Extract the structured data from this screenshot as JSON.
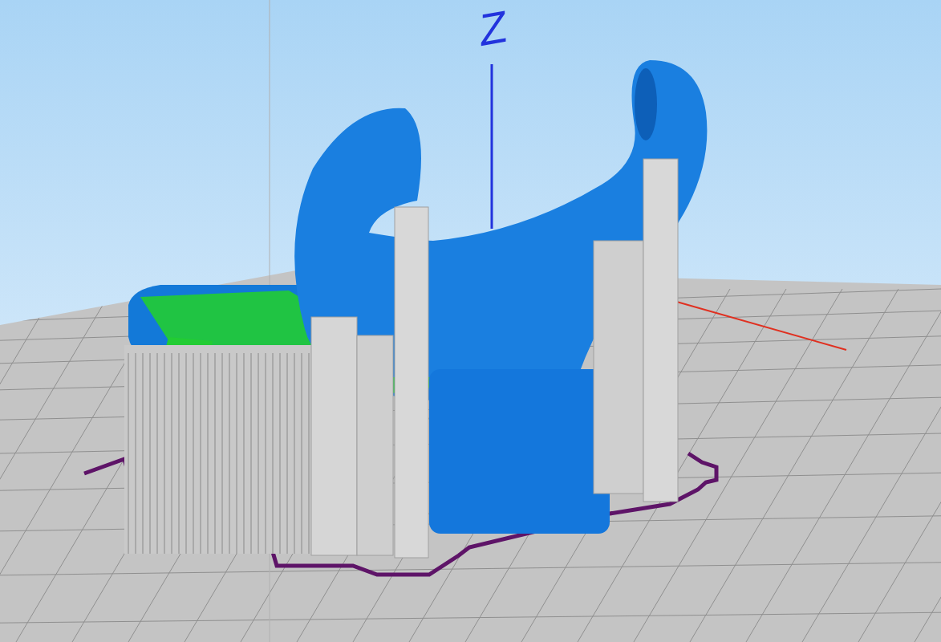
{
  "viewport": {
    "z_axis_label": "Z"
  }
}
